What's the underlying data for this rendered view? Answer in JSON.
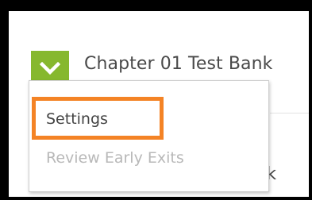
{
  "item": {
    "title": "Chapter 01 Test Bank",
    "title_partial_below": "ank"
  },
  "dropdown": {
    "icon": "chevron-down-icon",
    "accent_color": "#86b82e"
  },
  "menu": {
    "items": [
      {
        "label": "Settings",
        "enabled": true
      },
      {
        "label": "Review Early Exits",
        "enabled": false
      }
    ]
  },
  "annotation": {
    "highlight_color": "#f48325"
  }
}
